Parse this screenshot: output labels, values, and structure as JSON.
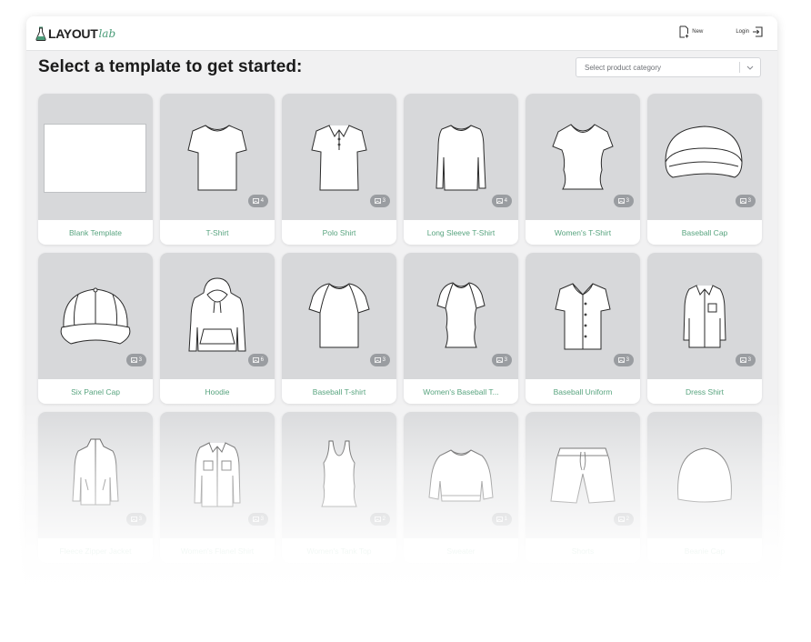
{
  "app": {
    "logo_main": "LAYOUT",
    "logo_sub": "lab",
    "new_label": "New",
    "login_label": "Login"
  },
  "page": {
    "title": "Select a template to get started:"
  },
  "category_select": {
    "value": "Select product category"
  },
  "templates": [
    {
      "label": "Blank Template",
      "icon": "blank-icon",
      "count": ""
    },
    {
      "label": "T-Shirt",
      "icon": "tshirt-icon",
      "count": "4"
    },
    {
      "label": "Polo Shirt",
      "icon": "polo-shirt-icon",
      "count": "3"
    },
    {
      "label": "Long Sleeve T-Shirt",
      "icon": "long-sleeve-icon",
      "count": "4"
    },
    {
      "label": "Women's T-Shirt",
      "icon": "womens-tshirt-icon",
      "count": "3"
    },
    {
      "label": "Baseball Cap",
      "icon": "baseball-cap-icon",
      "count": "3"
    },
    {
      "label": "Six Panel Cap",
      "icon": "six-panel-cap-icon",
      "count": "3"
    },
    {
      "label": "Hoodie",
      "icon": "hoodie-icon",
      "count": "6"
    },
    {
      "label": "Baseball T-shirt",
      "icon": "baseball-tshirt-icon",
      "count": "3"
    },
    {
      "label": "Women's Baseball T...",
      "icon": "womens-baseball-tshirt-icon",
      "count": "3"
    },
    {
      "label": "Baseball Uniform",
      "icon": "baseball-uniform-icon",
      "count": "3"
    },
    {
      "label": "Dress Shirt",
      "icon": "dress-shirt-icon",
      "count": "3"
    },
    {
      "label": "Fleece Zipper Jacket",
      "icon": "zipper-jacket-icon",
      "count": "3"
    },
    {
      "label": "Women's Flanel Shirt",
      "icon": "flannel-shirt-icon",
      "count": "3"
    },
    {
      "label": "Women's Tank Top",
      "icon": "tank-top-icon",
      "count": "2"
    },
    {
      "label": "Sweater",
      "icon": "sweater-icon",
      "count": "1"
    },
    {
      "label": "Shorts",
      "icon": "shorts-icon",
      "count": "2"
    },
    {
      "label": "Beanie Cap",
      "icon": "beanie-icon",
      "count": ""
    }
  ],
  "colors": {
    "accent": "#58a47f",
    "thumb_bg": "#d7d8da",
    "badge_bg": "#9a9da1"
  }
}
